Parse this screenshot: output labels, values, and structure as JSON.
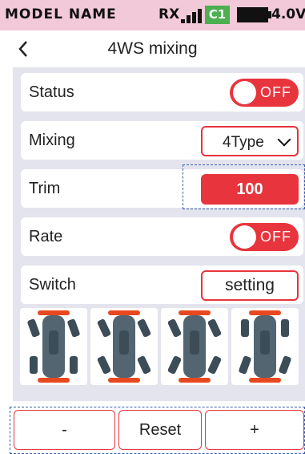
{
  "status_bar": {
    "model_name": "MODEL NAME",
    "rx_label": "RX",
    "signal_icon": "signal-bars-icon",
    "channel_badge": "C1",
    "battery_icon": "battery-icon",
    "battery_voltage": "4.0V"
  },
  "header": {
    "back_icon": "chevron-left-icon",
    "title": "4WS mixing"
  },
  "settings": {
    "status": {
      "label": "Status",
      "value": "OFF"
    },
    "mixing": {
      "label": "Mixing",
      "value": "4Type"
    },
    "trim": {
      "label": "Trim",
      "value": "100"
    },
    "rate": {
      "label": "Rate",
      "value": "OFF"
    },
    "switch": {
      "label": "Switch",
      "button": "setting"
    }
  },
  "mix_type_icons": [
    "front-steer-car-icon",
    "same-direction-steer-car-icon",
    "opposite-direction-steer-car-icon",
    "rear-steer-car-icon"
  ],
  "footer": {
    "minus": "-",
    "reset": "Reset",
    "plus": "+"
  },
  "colors": {
    "accent": "#e8343d",
    "status_bar_bg": "#f2c9d9",
    "panel_bg": "#e4e4ee",
    "badge_green": "#4caf50",
    "car_body": "#526571",
    "bumper": "#e8481f"
  }
}
